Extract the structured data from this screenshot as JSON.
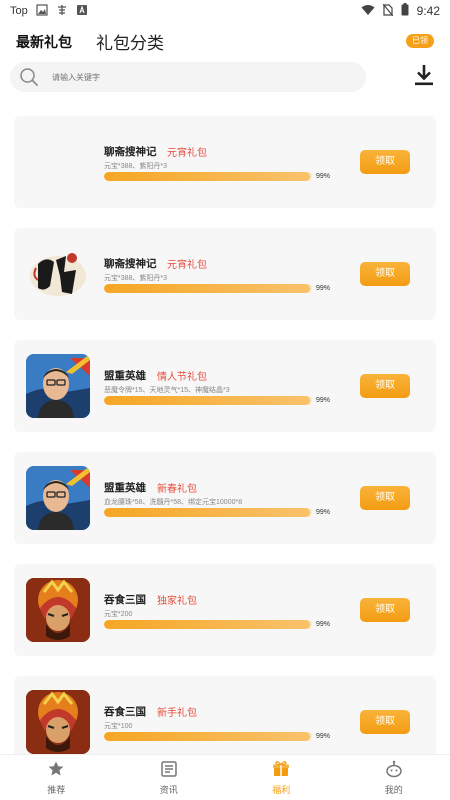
{
  "status": {
    "left_text": "Top",
    "time": "9:42"
  },
  "header": {
    "tab_new": "最新礼包",
    "tab_category": "礼包分类",
    "claimed_label": "已领"
  },
  "search": {
    "placeholder": "请输入关键字"
  },
  "cards": [
    {
      "title": "聊斋搜神记",
      "tag": "元宵礼包",
      "desc": "元宝*388、紫阳丹*3",
      "progress": 0.99,
      "pct": "99%",
      "claim": "领取",
      "has_thumb": false
    },
    {
      "title": "聊斋搜神记",
      "tag": "元宵礼包",
      "desc": "元宝*388、紫阳丹*3",
      "progress": 0.99,
      "pct": "99%",
      "claim": "领取",
      "has_thumb": true
    },
    {
      "title": "盟重英雄",
      "tag": "情人节礼包",
      "desc": "恶魔令牌*15、天地灵气*15、神魔结晶*3",
      "progress": 0.99,
      "pct": "99%",
      "claim": "领取",
      "has_thumb": true
    },
    {
      "title": "盟重英雄",
      "tag": "新春礼包",
      "desc": "血龙腰珠*58、洗髓丹*58、绑定元宝10000*8",
      "progress": 0.99,
      "pct": "99%",
      "claim": "领取",
      "has_thumb": true
    },
    {
      "title": "吞食三国",
      "tag": "独家礼包",
      "desc": "元宝*200",
      "progress": 0.99,
      "pct": "99%",
      "claim": "领取",
      "has_thumb": true
    },
    {
      "title": "吞食三国",
      "tag": "新手礼包",
      "desc": "元宝*100",
      "progress": 0.99,
      "pct": "99%",
      "claim": "领取",
      "has_thumb": true
    }
  ],
  "nav": [
    {
      "label": "推荐",
      "icon": "recommend-icon",
      "active": false
    },
    {
      "label": "资讯",
      "icon": "news-icon",
      "active": false
    },
    {
      "label": "福利",
      "icon": "gift-icon",
      "active": true
    },
    {
      "label": "我的",
      "icon": "profile-icon",
      "active": false
    }
  ],
  "colors": {
    "accent": "#f39c12",
    "tag": "#e74c3c",
    "card_bg": "#f7f7f7"
  }
}
